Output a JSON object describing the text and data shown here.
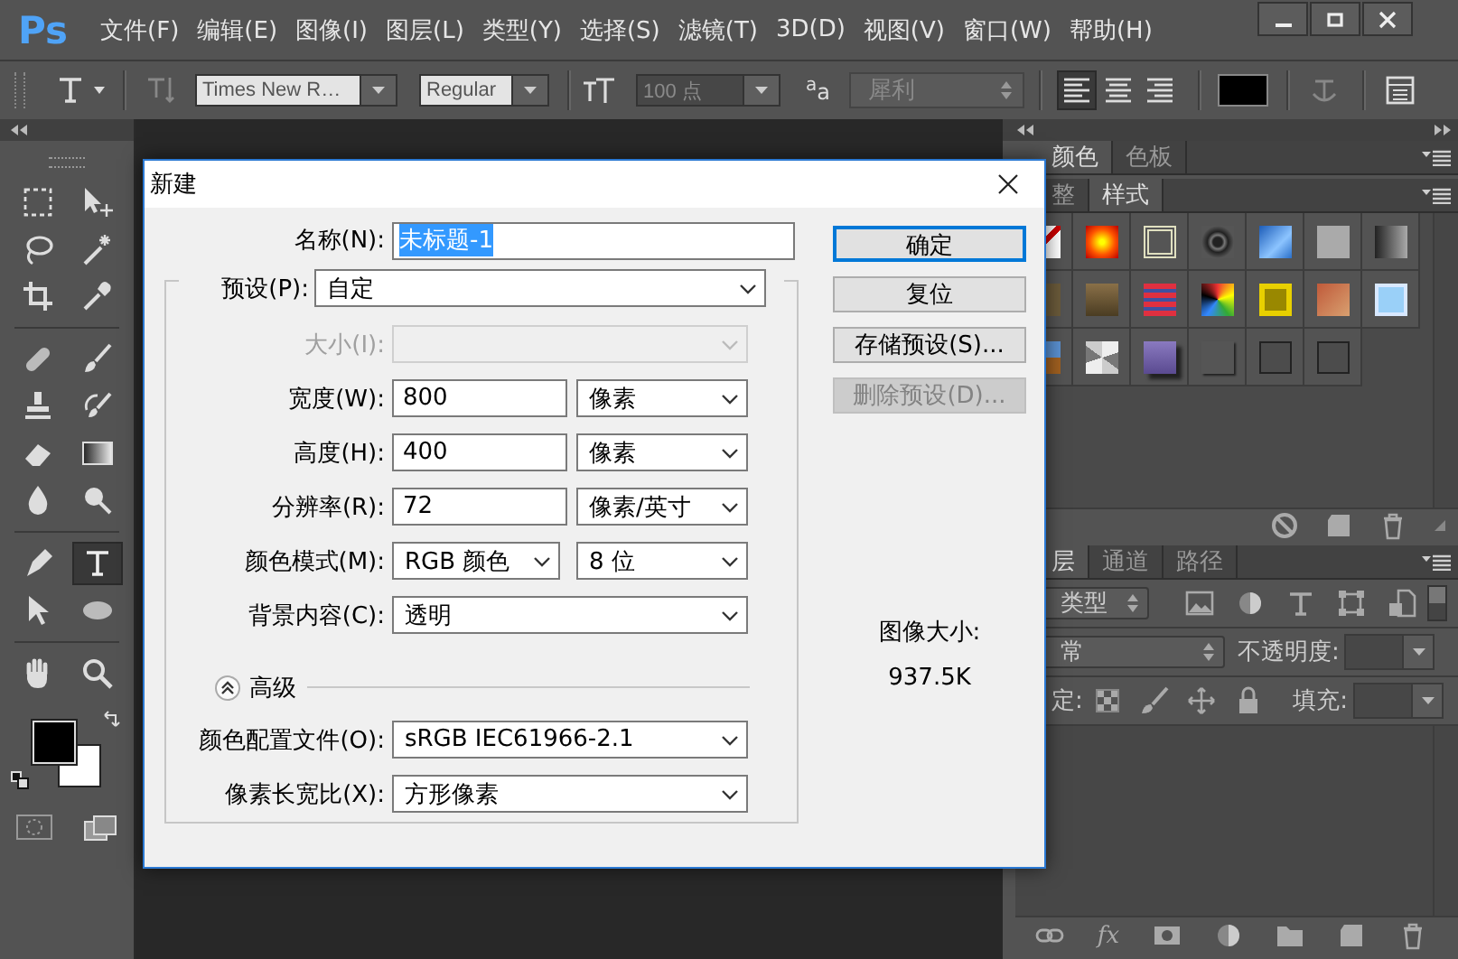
{
  "app": {
    "logo": "Ps"
  },
  "menu": [
    "文件(F)",
    "编辑(E)",
    "图像(I)",
    "图层(L)",
    "类型(Y)",
    "选择(S)",
    "滤镜(T)",
    "3D(D)",
    "视图(V)",
    "窗口(W)",
    "帮助(H)"
  ],
  "options_bar": {
    "font_family": "Times New R…",
    "font_style": "Regular",
    "font_size": {
      "value": "100 点",
      "disabled": true
    },
    "antialias_icon": "$^{a}$a",
    "antialias": {
      "value": "犀利",
      "disabled": true
    },
    "align": [
      {
        "selected": true
      },
      {
        "selected": false
      },
      {
        "selected": false
      }
    ]
  },
  "tools": [
    {
      "selected": false
    },
    {
      "selected": false
    },
    {
      "selected": false
    },
    {
      "selected": false
    },
    {
      "selected": false
    },
    {
      "selected": false
    },
    {
      "selected": false
    },
    {
      "selected": false
    },
    {
      "selected": false
    },
    {
      "selected": false
    },
    {
      "selected": false
    },
    {
      "selected": false
    },
    {
      "selected": false
    },
    {
      "selected": false
    },
    {
      "selected": false
    },
    {
      "selected": true
    },
    {
      "selected": false
    },
    {
      "selected": false
    },
    {
      "selected": false
    },
    {
      "selected": false
    }
  ],
  "panels": {
    "color_group": {
      "tabs": [
        {
          "label": "颜色",
          "selected": true
        },
        {
          "label": "色板",
          "selected": false
        }
      ]
    },
    "styles_group": {
      "tabs": [
        {
          "label": "整",
          "selected": false
        },
        {
          "label": "样式",
          "selected": true
        }
      ]
    },
    "layers": {
      "tabs": [
        {
          "label": "层",
          "selected": true
        },
        {
          "label": "通道",
          "selected": false
        },
        {
          "label": "路径",
          "selected": false
        }
      ],
      "filter": "类型",
      "blend_mode": "常",
      "opacity_label": "不透明度:",
      "lock_label": "定:",
      "fill_label": "填充:",
      "fx": "fx"
    }
  },
  "dialog": {
    "title": "新建",
    "name": {
      "label": "名称(N):",
      "value": "未标题-1",
      "value_selected": true
    },
    "preset": {
      "label": "预设(P):",
      "value": "自定"
    },
    "size": {
      "label": "大小(I):",
      "disabled": true
    },
    "width": {
      "label": "宽度(W):",
      "value": "800",
      "unit": "像素"
    },
    "height": {
      "label": "高度(H):",
      "value": "400",
      "unit": "像素"
    },
    "resolution": {
      "label": "分辨率(R):",
      "value": "72",
      "unit": "像素/英寸"
    },
    "color_mode": {
      "label": "颜色模式(M):",
      "value": "RGB 颜色",
      "depth": "8 位"
    },
    "background": {
      "label": "背景内容(C):",
      "value": "透明"
    },
    "advanced": {
      "label": "高级",
      "expanded": true
    },
    "color_profile": {
      "label": "颜色配置文件(O):",
      "value": "sRGB IEC61966-2.1"
    },
    "pixel_aspect": {
      "label": "像素长宽比(X):",
      "value": "方形像素"
    },
    "buttons": [
      {
        "label": "确定",
        "default": true,
        "disabled": false
      },
      {
        "label": "复位",
        "default": false,
        "disabled": false
      },
      {
        "label": "存储预设(S)...",
        "default": false,
        "disabled": false
      },
      {
        "label": "删除预设(D)...",
        "default": false,
        "disabled": true
      }
    ],
    "image_size": {
      "label": "图像大小:",
      "value": "937.5K"
    }
  }
}
